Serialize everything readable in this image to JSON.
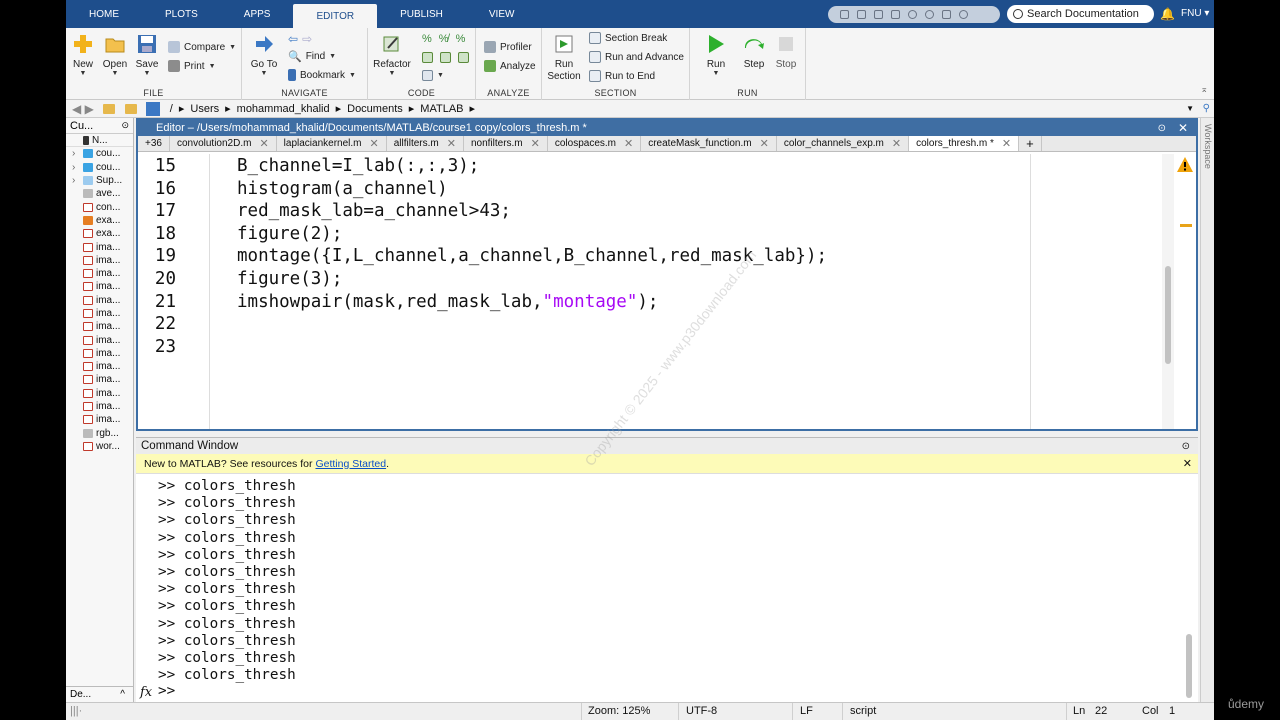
{
  "tabs": [
    "HOME",
    "PLOTS",
    "APPS",
    "EDITOR",
    "PUBLISH",
    "VIEW"
  ],
  "active_tab": "EDITOR",
  "search": {
    "placeholder": "Search Documentation"
  },
  "user": "FNU",
  "ribbon": {
    "file": {
      "label": "FILE",
      "new": "New",
      "open": "Open",
      "save": "Save",
      "compare": "Compare",
      "print": "Print"
    },
    "navigate": {
      "label": "NAVIGATE",
      "goto": "Go To",
      "find": "Find",
      "bookmark": "Bookmark"
    },
    "code": {
      "label": "CODE",
      "refactor": "Refactor"
    },
    "analyze": {
      "label": "ANALYZE",
      "profiler": "Profiler",
      "analyze": "Analyze"
    },
    "section": {
      "label": "SECTION",
      "run_section": "Run Section",
      "section_break": "Section Break",
      "run_advance": "Run and Advance",
      "run_end": "Run to End"
    },
    "run": {
      "label": "RUN",
      "run": "Run",
      "step": "Step",
      "stop": "Stop"
    }
  },
  "path": [
    "/",
    "Users",
    "mohammad_khalid",
    "Documents",
    "MATLAB"
  ],
  "left_panel": {
    "title": "Cu...",
    "header_col": "N...",
    "files": [
      {
        "name": "cou...",
        "type": "folder"
      },
      {
        "name": "cou...",
        "type": "folder"
      },
      {
        "name": "Sup...",
        "type": "folder-light"
      },
      {
        "name": "ave...",
        "type": "other"
      },
      {
        "name": "con...",
        "type": "m"
      },
      {
        "name": "exa...",
        "type": "fig"
      },
      {
        "name": "exa...",
        "type": "m"
      },
      {
        "name": "ima...",
        "type": "m"
      },
      {
        "name": "ima...",
        "type": "m"
      },
      {
        "name": "ima...",
        "type": "m"
      },
      {
        "name": "ima...",
        "type": "m"
      },
      {
        "name": "ima...",
        "type": "m"
      },
      {
        "name": "ima...",
        "type": "m"
      },
      {
        "name": "ima...",
        "type": "m"
      },
      {
        "name": "ima...",
        "type": "m"
      },
      {
        "name": "ima...",
        "type": "m"
      },
      {
        "name": "ima...",
        "type": "m"
      },
      {
        "name": "ima...",
        "type": "m"
      },
      {
        "name": "ima...",
        "type": "m"
      },
      {
        "name": "ima...",
        "type": "m"
      },
      {
        "name": "ima...",
        "type": "m"
      },
      {
        "name": "rgb...",
        "type": "other"
      },
      {
        "name": "wor...",
        "type": "m"
      }
    ],
    "footer": "De..."
  },
  "workspace_label": "Workspace",
  "editor": {
    "title": "Editor – /Users/mohammad_khalid/Documents/MATLAB/course1 copy/colors_thresh.m *",
    "overflow_count": "36",
    "files": [
      "convolution2D.m",
      "laplaciankernel.m",
      "allfilters.m",
      "nonfilters.m",
      "colospaces.m",
      "createMask_function.m",
      "color_channels_exp.m",
      "colors_thresh.m *"
    ],
    "active_file_index": 7,
    "lines": [
      {
        "num": "15",
        "text": "B_channel=I_lab(:,:,3);"
      },
      {
        "num": "16",
        "text": "histogram(a_channel)"
      },
      {
        "num": "17",
        "text": "red_mask_lab=a_channel>43;"
      },
      {
        "num": "18",
        "text": "figure(2);"
      },
      {
        "num": "19",
        "text": "montage({I,L_channel,a_channel,B_channel,red_mask_lab});"
      },
      {
        "num": "20",
        "text": "figure(3);"
      },
      {
        "num": "21",
        "text": "imshowpair(mask,red_mask_lab,",
        "str": "\"montage\"",
        "tail": ");"
      },
      {
        "num": "22",
        "text": ""
      },
      {
        "num": "23",
        "text": ""
      }
    ]
  },
  "command_window": {
    "title": "Command Window",
    "banner_text": "New to MATLAB? See resources for",
    "banner_link": "Getting Started",
    "banner_end": ".",
    "history": [
      ">> colors_thresh",
      ">> colors_thresh",
      ">> colors_thresh",
      ">> colors_thresh",
      ">> colors_thresh",
      ">> colors_thresh",
      ">> colors_thresh",
      ">> colors_thresh",
      ">> colors_thresh",
      ">> colors_thresh",
      ">> colors_thresh",
      ">> colors_thresh"
    ],
    "prompt": ">>",
    "fx": "fx"
  },
  "status": {
    "zoom": "Zoom: 125%",
    "encoding": "UTF-8",
    "eol": "LF",
    "type": "script",
    "ln_label": "Ln",
    "ln": "22",
    "col_label": "Col",
    "col": "1"
  },
  "watermark": "Copyright © 2025 - www.p30download.com",
  "udemy": "ůdemy"
}
